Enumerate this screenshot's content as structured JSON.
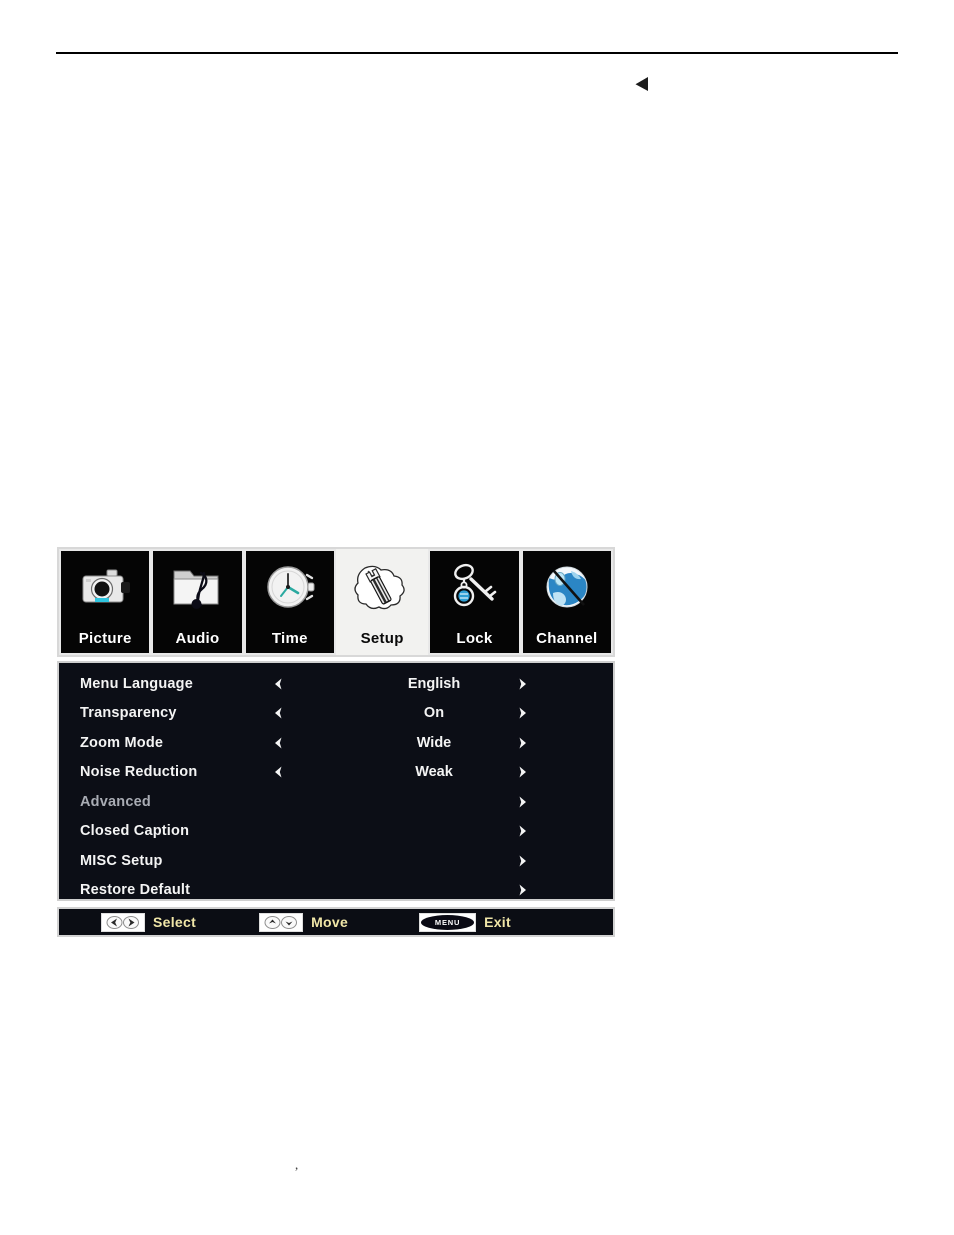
{
  "page": {
    "header_arrow_icon": "left-triangle-arrow",
    "stray_mark": ","
  },
  "osd": {
    "tabs": [
      {
        "label": "Picture",
        "icon": "camera-icon",
        "selected": false
      },
      {
        "label": "Audio",
        "icon": "music-folder-icon",
        "selected": false
      },
      {
        "label": "Time",
        "icon": "clock-icon",
        "selected": false
      },
      {
        "label": "Setup",
        "icon": "wrench-icon",
        "selected": true
      },
      {
        "label": "Lock",
        "icon": "key-icon",
        "selected": false
      },
      {
        "label": "Channel",
        "icon": "globe-antenna-icon",
        "selected": false
      }
    ],
    "menu": [
      {
        "label": "Menu Language",
        "value": "English",
        "left_arrow": true,
        "right_arrow": true,
        "dim": false
      },
      {
        "label": "Transparency",
        "value": "On",
        "left_arrow": true,
        "right_arrow": true,
        "dim": false
      },
      {
        "label": "Zoom Mode",
        "value": "Wide",
        "left_arrow": true,
        "right_arrow": true,
        "dim": false
      },
      {
        "label": "Noise Reduction",
        "value": "Weak",
        "left_arrow": true,
        "right_arrow": true,
        "dim": false
      },
      {
        "label": "Advanced",
        "value": "",
        "left_arrow": false,
        "right_arrow": true,
        "dim": true
      },
      {
        "label": "Closed Caption",
        "value": "",
        "left_arrow": false,
        "right_arrow": true,
        "dim": false
      },
      {
        "label": "MISC Setup",
        "value": "",
        "left_arrow": false,
        "right_arrow": true,
        "dim": false
      },
      {
        "label": "Restore Default",
        "value": "",
        "left_arrow": false,
        "right_arrow": true,
        "dim": false
      }
    ],
    "hints": [
      {
        "label": "Select",
        "icon": "left-right-arrow-keys",
        "key_text": ""
      },
      {
        "label": "Move",
        "icon": "up-down-arrow-keys",
        "key_text": ""
      },
      {
        "label": "Exit",
        "icon": "menu-button",
        "key_text": "MENU"
      }
    ]
  },
  "colors": {
    "panel_bg": "#0c0e16",
    "panel_border": "#cfcfcf",
    "label_text": "#f4f4f4",
    "dim_text": "#a9acb4",
    "hint_text": "#f0e6a8",
    "selected_tab_bg": "#f2f2f0"
  }
}
